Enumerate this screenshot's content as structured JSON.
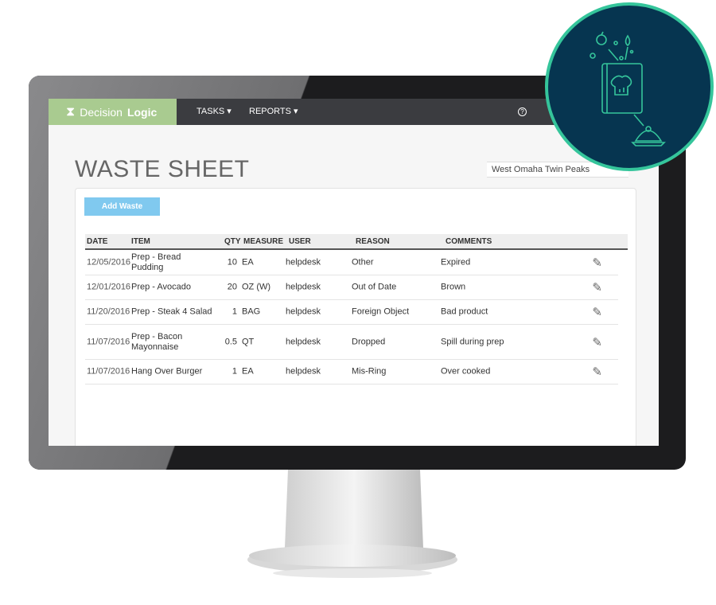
{
  "app": {
    "brand_light": "Decision",
    "brand_bold": "Logic"
  },
  "nav": {
    "items": [
      {
        "label": "TASKS ▾"
      },
      {
        "label": "REPORTS ▾"
      }
    ],
    "help_icon": "?"
  },
  "page": {
    "title": "WASTE SHEET",
    "location": "West Omaha Twin Peaks",
    "add_button": "Add Waste"
  },
  "table": {
    "columns": [
      "DATE",
      "ITEM",
      "QTY",
      "MEASURE",
      "USER",
      "REASON",
      "COMMENTS"
    ],
    "rows": [
      {
        "date": "12/05/2016",
        "item": "Prep - Bread Pudding",
        "qty": "10",
        "measure": "EA",
        "user": "helpdesk",
        "reason": "Other",
        "comments": "Expired"
      },
      {
        "date": "12/01/2016",
        "item": "Prep - Avocado",
        "qty": "20",
        "measure": "OZ (W)",
        "user": "helpdesk",
        "reason": "Out of Date",
        "comments": "Brown"
      },
      {
        "date": "11/20/2016",
        "item": "Prep - Steak 4 Salad",
        "qty": "1",
        "measure": "BAG",
        "user": "helpdesk",
        "reason": "Foreign Object",
        "comments": "Bad product"
      },
      {
        "date": "11/07/2016",
        "item": "Prep - Bacon Mayonnaise",
        "qty": "0.5",
        "measure": "QT",
        "user": "helpdesk",
        "reason": "Dropped",
        "comments": "Spill during prep"
      },
      {
        "date": "11/07/2016",
        "item": "Hang Over Burger",
        "qty": "1",
        "measure": "EA",
        "user": "helpdesk",
        "reason": "Mis-Ring",
        "comments": "Over cooked"
      }
    ]
  },
  "colors": {
    "brand_green": "#a9cb90",
    "nav_dark": "#3b3c40",
    "button_blue": "#80c9ef",
    "badge_navy": "#063550",
    "badge_ring": "#35c59b"
  },
  "icons": {
    "edit": "pencil-icon",
    "badge": "recipe-book-icon"
  }
}
